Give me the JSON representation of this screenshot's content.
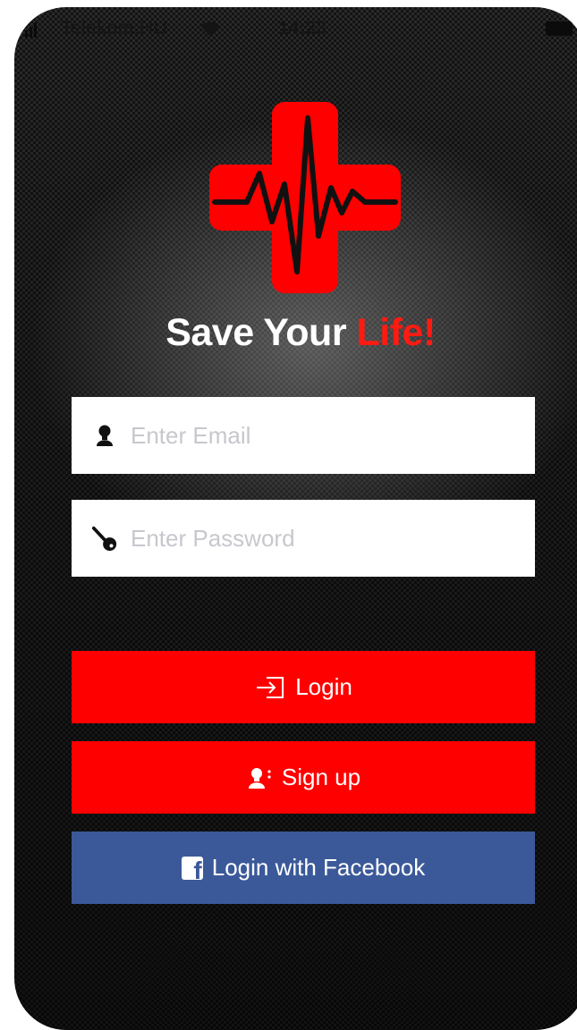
{
  "status_bar": {
    "carrier": "Telekom.HU",
    "time": "14:23"
  },
  "app": {
    "title_main": "Save Your ",
    "title_accent": "Life!",
    "brand_color": "#ff0000",
    "logo_icon": "medical-cross-heartbeat-icon"
  },
  "form": {
    "email": {
      "placeholder": "Enter Email",
      "value": "",
      "icon": "user-icon"
    },
    "password": {
      "placeholder": "Enter Password",
      "value": "",
      "icon": "key-icon"
    }
  },
  "buttons": {
    "login": {
      "label": "Login",
      "icon": "sign-in-icon",
      "color": "#ff0000"
    },
    "signup": {
      "label": "Sign up",
      "icon": "add-user-icon",
      "color": "#ff0000"
    },
    "facebook": {
      "label": "Login with Facebook",
      "icon": "facebook-icon",
      "color": "#3b5999"
    }
  }
}
